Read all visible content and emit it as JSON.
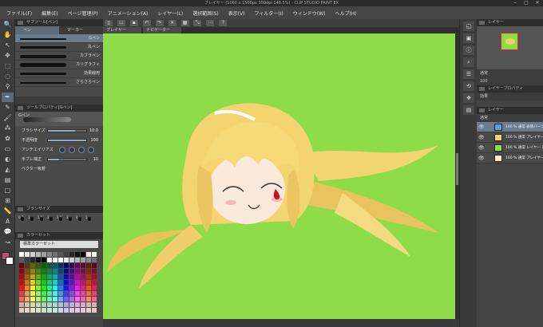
{
  "window": {
    "title": "プレイヤー (1060 x 1500px 350dpi 148.5%) - CLIP STUDIO PAINT EX",
    "minimize": "−",
    "maximize": "□",
    "close": "✕"
  },
  "menu": [
    "ファイル(F)",
    "編集(E)",
    "ページ管理(P)",
    "アニメーション(A)",
    "レイヤー(L)",
    "選択範囲(S)",
    "表示(V)",
    "フィルター(I)",
    "ウィンドウ(W)",
    "ヘルプ(H)"
  ],
  "left": {
    "subtool_header": "サブツール[ペン]",
    "tabs": [
      "ペン",
      "マーカー"
    ],
    "brushes": [
      "Gペン",
      "丸ペン",
      "カブラペン",
      "カリグラフィ",
      "効果線用",
      "さらさらペン"
    ],
    "toolprop_header": "ツールプロパティ[Gペン]",
    "preview_label": "Gペン",
    "props": [
      {
        "label": "ブラシサイズ",
        "value": "10.0",
        "level": 0.7
      },
      {
        "label": "不透明度",
        "value": "100",
        "level": 1.0
      },
      {
        "label": "アンチエイリアス",
        "value": ""
      },
      {
        "label": "手ブレ補正",
        "value": "10",
        "level": 0.3
      },
      {
        "label": "ベクター吸着",
        "value": ""
      }
    ],
    "brushsize_header": "ブラシサイズ",
    "brushsizes": [
      "0.7",
      "1",
      "1.5",
      "2",
      "2.5",
      "3",
      "4",
      "5"
    ],
    "colorset_header": "カラーセット",
    "colorset_dropdown": "標準カラーセット"
  },
  "canvas": {
    "tab_label": "プレイヤー",
    "tab2_label": "ナビゲーター",
    "bg_color": "#8fdc4a"
  },
  "right": {
    "nav_header": "レイヤー",
    "layerprop_header": "レイヤープロパティ",
    "effect_label": "効果",
    "blend_label": "通常",
    "opacity_label": "100",
    "layers": [
      {
        "name": "100 % 通常 表情パーツ",
        "selected": true
      },
      {
        "name": "100 % 通常 プレイヤーピース 1",
        "selected": false
      },
      {
        "name": "100 % 通常 レイヤー 1",
        "selected": false
      },
      {
        "name": "100 % 通常 プレイヤー",
        "selected": false
      }
    ]
  }
}
